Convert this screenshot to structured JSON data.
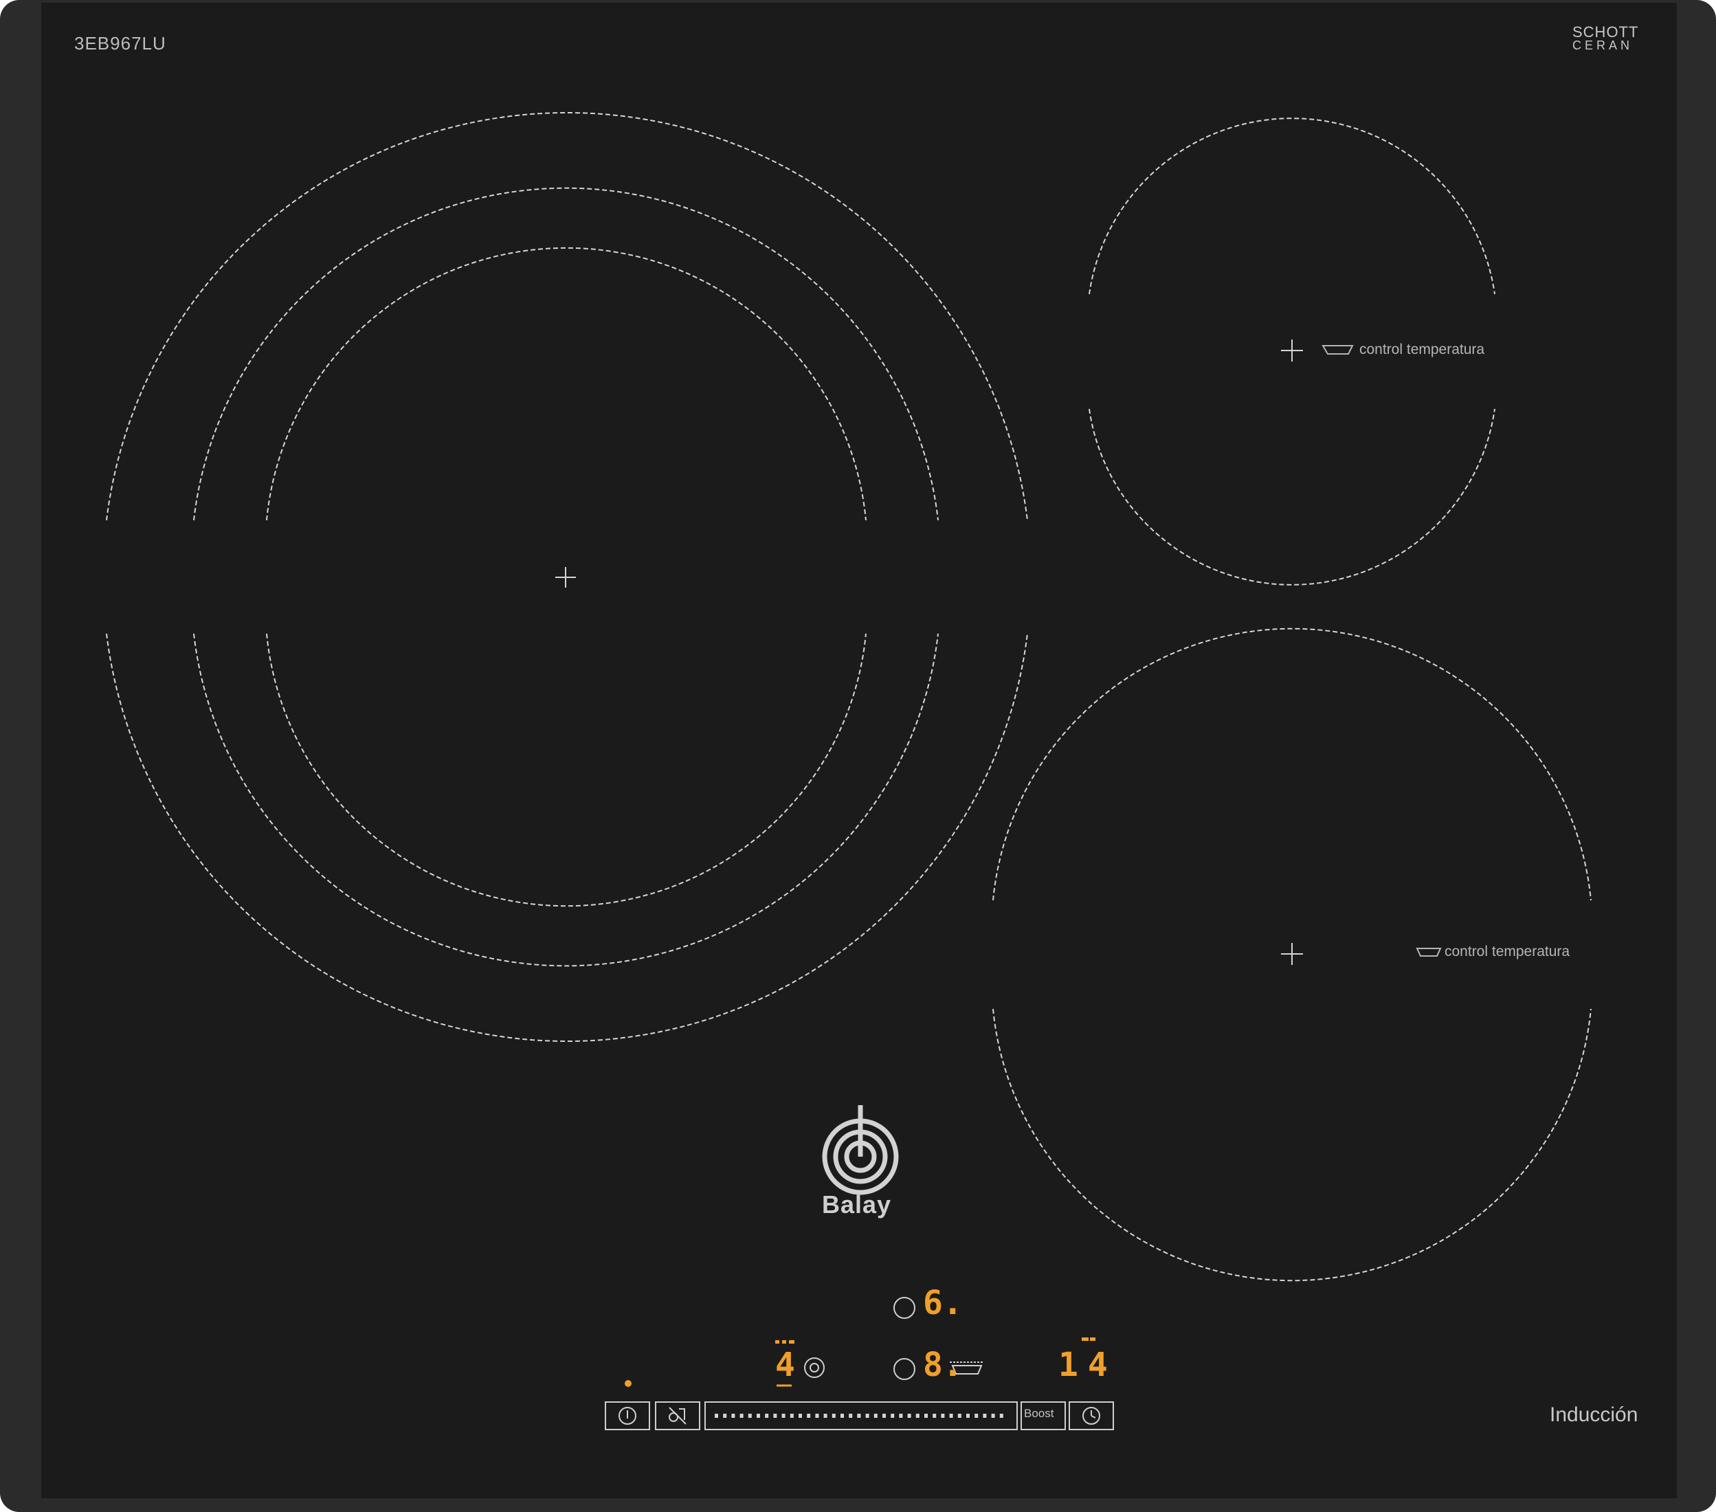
{
  "product": {
    "model_code": "3EB967LU",
    "glass_brand_line1": "SCHOTT",
    "glass_brand_line2": "CERAN",
    "brand_name": "Balay",
    "technology_label": "Inducción"
  },
  "zones": {
    "right_top_feature": "control temperatura",
    "right_bottom_feature": "control temperatura"
  },
  "controls": {
    "display_left": "4",
    "display_center_top": "6.",
    "display_center_bottom": "8.",
    "display_timer": "14",
    "boost_label": "Boost"
  },
  "colors": {
    "glass": "#1b1b1b",
    "frame": "#2b2b2b",
    "zone_lines": "#d6d6d6",
    "display": "#f0a02a",
    "controls_outline": "#cfcfcf"
  }
}
